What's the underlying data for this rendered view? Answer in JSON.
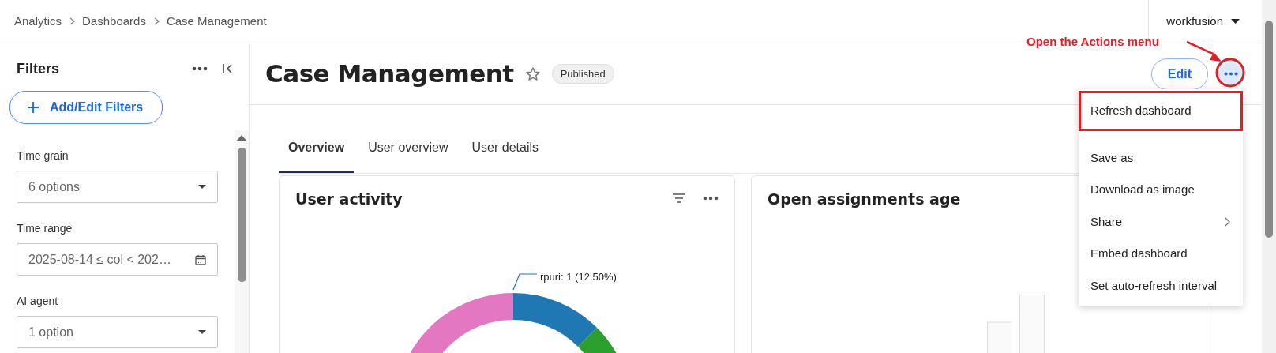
{
  "breadcrumb": [
    "Analytics",
    "Dashboards",
    "Case Management"
  ],
  "user_menu": {
    "label": "workfusion"
  },
  "sidebar": {
    "title": "Filters",
    "add_button": "Add/Edit Filters",
    "filters": [
      {
        "label": "Time grain",
        "kind": "select",
        "value": "6 options"
      },
      {
        "label": "Time range",
        "kind": "date",
        "value": "2025-08-14 ≤ col < 202…"
      },
      {
        "label": "AI agent",
        "kind": "select",
        "value": "1 option"
      }
    ]
  },
  "header": {
    "title": "Case Management",
    "starred": false,
    "badge": "Published",
    "edit_button": "Edit"
  },
  "tabs": [
    {
      "label": "Overview",
      "selected": true
    },
    {
      "label": "User overview",
      "selected": false
    },
    {
      "label": "User details",
      "selected": false
    }
  ],
  "cards": [
    {
      "title": "User activity",
      "kind": "donut",
      "slice_label": "rpuri: 1 (12.50%)"
    },
    {
      "title": "Open assignments age",
      "kind": "bars"
    }
  ],
  "actions_menu": {
    "items": [
      {
        "label": "Refresh dashboard",
        "submenu": false,
        "highlighted": true
      },
      {
        "label": "Save as",
        "submenu": false,
        "highlighted": false
      },
      {
        "label": "Download as image",
        "submenu": false,
        "highlighted": false
      },
      {
        "label": "Share",
        "submenu": true,
        "highlighted": false
      },
      {
        "label": "Embed dashboard",
        "submenu": false,
        "highlighted": false
      },
      {
        "label": "Set auto-refresh interval",
        "submenu": false,
        "highlighted": false
      }
    ]
  },
  "annotation": {
    "text": "Open the Actions menu"
  }
}
